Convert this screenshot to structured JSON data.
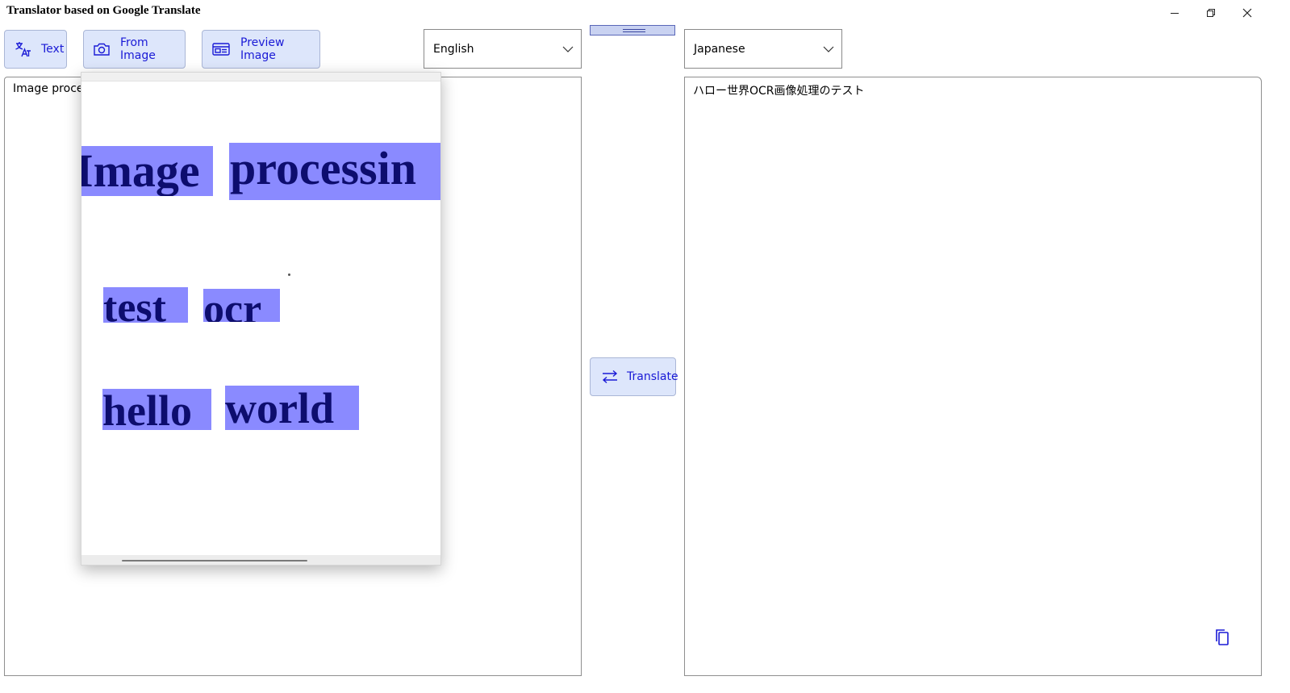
{
  "window": {
    "title": "Translator based on Google Translate"
  },
  "toolbar": {
    "text_label": "Text",
    "from_image_label": "From Image",
    "preview_image_label": "Preview Image"
  },
  "languages": {
    "source": "English",
    "target": "Japanese"
  },
  "source_pane": {
    "text": "Image processing test ocr hello world"
  },
  "target_pane": {
    "text": "ハロー世界OCR画像処理のテスト"
  },
  "translate": {
    "label": "Translate"
  },
  "preview": {
    "words": [
      "Image",
      "processin",
      "test",
      "ocr",
      "hello",
      "world"
    ]
  },
  "colors": {
    "accent_text": "#1a1ad6",
    "button_bg": "#dde6fb",
    "ocr_highlight": "#8a8aff",
    "ocr_text": "#0d0d6e"
  },
  "icons": {
    "text_button": "translate-icon",
    "from_image_button": "camera-icon",
    "preview_button": "preview-image-icon",
    "translate_button": "swap-arrows-icon",
    "copy_button": "copy-icon",
    "dropdown": "chevron-down-icon"
  }
}
